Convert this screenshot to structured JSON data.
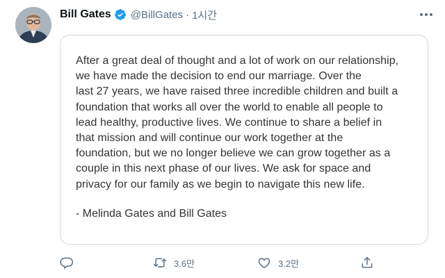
{
  "author": {
    "name": "Bill Gates",
    "handle": "@BillGates",
    "separator": "·",
    "time": "1시간",
    "verified": true
  },
  "icons": {
    "verified": "verified-badge-icon",
    "more": "more-options-icon",
    "reply": "reply-icon",
    "retweet": "retweet-icon",
    "like": "like-icon",
    "share": "share-icon"
  },
  "statement": {
    "lines": [
      "After a great deal of thought and a lot of work on our relationship,",
      "we have made the decision to end our marriage. Over the",
      "last 27 years, we have raised three incredible children and built a",
      "foundation that works all over the world to enable all people to",
      "lead healthy, productive lives. We continue to share a belief in",
      "that mission and will continue our work together at the",
      "foundation, but we no longer believe we can grow together as a",
      "couple in this next phase of our lives. We ask for space and",
      "privacy for our family as we begin to navigate this new life."
    ],
    "signature": "- Melinda Gates and Bill Gates"
  },
  "actions": {
    "retweet_count": "3.6만",
    "like_count": "3.2만"
  },
  "colors": {
    "verified_blue": "#1d9bf0",
    "secondary_text": "#5b7083",
    "card_border": "#cfd9de"
  }
}
